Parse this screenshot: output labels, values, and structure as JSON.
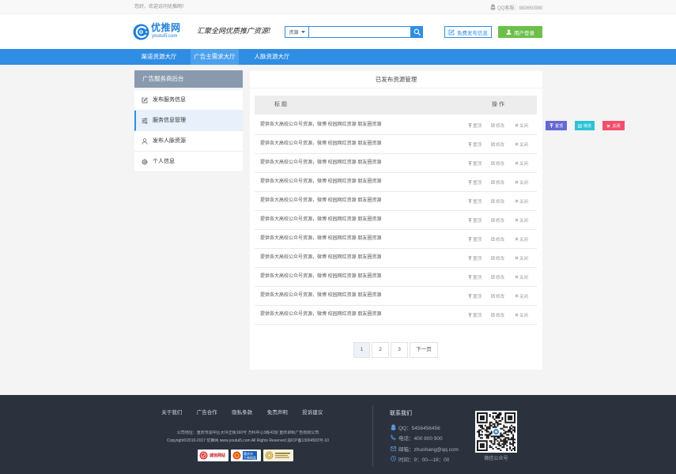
{
  "colors": {
    "primary": "#2f8de4",
    "nav_active": "#4ba0ed",
    "login": "#6cc04a",
    "top_button": "#6668d4",
    "edit_button": "#2cc3d5",
    "close_button": "#f34f6d",
    "footer": "#2b323e",
    "sidebar_header": "#8999ae",
    "sidebar_active": "#e7f0fb"
  },
  "topbar": {
    "welcome": "您好，欢迎访问优推网！",
    "qq_service": "QQ客服：983650990",
    "qq_icon": "qq-icon"
  },
  "header": {
    "logo_name": "优推网",
    "logo_domain": "youtui5.com",
    "slogan": "汇聚全网优质推广资源!",
    "search": {
      "category": "资源",
      "value": "",
      "button_icon": "search-icon"
    },
    "publish_button": "免费发布信息",
    "login_button": "用户登录"
  },
  "nav": {
    "items": [
      {
        "label": "渠道资源大厅",
        "active": false
      },
      {
        "label": "广告主需求大厅",
        "active": true
      },
      {
        "label": "人脉资源大厅",
        "active": false
      }
    ]
  },
  "sidebar": {
    "title": "广告服务商后台",
    "items": [
      {
        "label": "发布服务信息",
        "icon": "edit-icon",
        "active": false
      },
      {
        "label": "服务信息管理",
        "icon": "sliders-icon",
        "active": true
      },
      {
        "label": "发布人脉资源",
        "icon": "user-icon",
        "active": false
      },
      {
        "label": "个人信息",
        "icon": "gear-icon",
        "active": false
      }
    ]
  },
  "main": {
    "title": "已发布资源管理",
    "columns": {
      "title": "标 题",
      "actions": "操 作"
    },
    "rows": [
      {
        "title": "提供各大高校公众号资源，微博 校园网红资源 朋友圈资源",
        "top": "置顶",
        "edit": "修改",
        "close": "关闭"
      },
      {
        "title": "提供各大高校公众号资源，微博 校园网红资源 朋友圈资源",
        "top": "置顶",
        "edit": "修改",
        "close": "关闭"
      },
      {
        "title": "提供各大高校公众号资源，微博 校园网红资源 朋友圈资源",
        "top": "置顶",
        "edit": "修改",
        "close": "关闭"
      },
      {
        "title": "提供各大高校公众号资源，微博 校园网红资源 朋友圈资源",
        "top": "置顶",
        "edit": "修改",
        "close": "关闭"
      },
      {
        "title": "提供各大高校公众号资源，微博 校园网红资源 朋友圈资源",
        "top": "置顶",
        "edit": "修改",
        "close": "关闭"
      },
      {
        "title": "提供各大高校公众号资源，微博 校园网红资源 朋友圈资源",
        "top": "置顶",
        "edit": "修改",
        "close": "关闭"
      },
      {
        "title": "提供各大高校公众号资源，微博 校园网红资源 朋友圈资源",
        "top": "置顶",
        "edit": "修改",
        "close": "关闭"
      },
      {
        "title": "提供各大高校公众号资源，微博 校园网红资源 朋友圈资源",
        "top": "置顶",
        "edit": "修改",
        "close": "关闭"
      },
      {
        "title": "提供各大高校公众号资源，微博 校园网红资源 朋友圈资源",
        "top": "置顶",
        "edit": "修改",
        "close": "关闭"
      },
      {
        "title": "提供各大高校公众号资源，微博 校园网红资源 朋友圈资源",
        "top": "置顶",
        "edit": "修改",
        "close": "关闭"
      },
      {
        "title": "提供各大高校公众号资源，微博 校园网红资源 朋友圈资源",
        "top": "置顶",
        "edit": "修改",
        "close": "关闭"
      }
    ]
  },
  "action_buttons": {
    "top": "置顶",
    "edit": "修改",
    "close": "关闭"
  },
  "pagination": {
    "pages": [
      {
        "label": "1",
        "active": true
      },
      {
        "label": "2",
        "active": false
      },
      {
        "label": "3",
        "active": false
      }
    ],
    "next": "下一页"
  },
  "footer": {
    "links": [
      "关于我们",
      "广告合作",
      "隐私条款",
      "免责声明",
      "投诉建议"
    ],
    "address": "公司地址：重庆市渝中区大坪正街160号 万科中心3栋42层 重庆卓帆广告有限公司",
    "copyright": "Copyright©2010-2017  优推网 www.youtui5.com All Rights Reserved  渝ICP备13004503号-10",
    "badges": [
      {
        "text": "诚信网站"
      },
      {
        "lines": [
          "重庆市",
          "工商网监"
        ]
      }
    ],
    "contact": {
      "title": "联系我们",
      "qq": "QQ：5456456456",
      "phone": "电话：400 800 900",
      "email": "邮箱：zhuohang@qq.com",
      "hours": "时间：9：00—18：00"
    },
    "qr_caption": "微信公众号"
  }
}
